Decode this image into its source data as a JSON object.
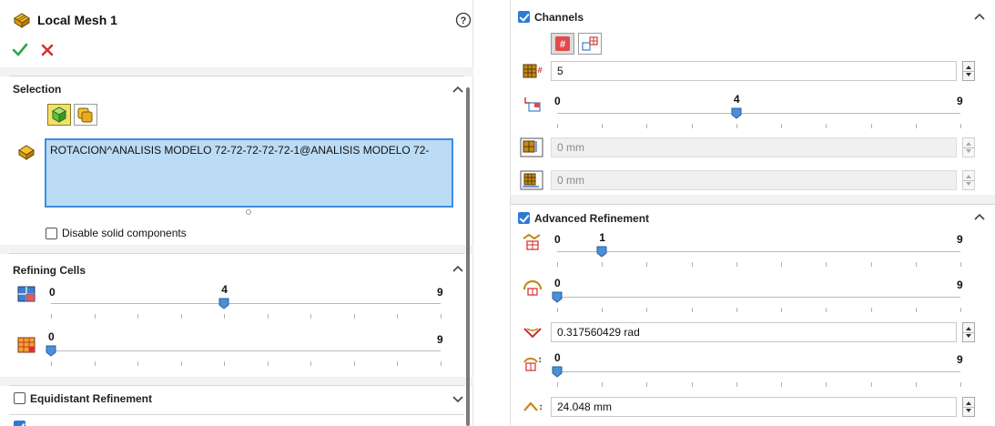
{
  "left": {
    "title": "Local Mesh 1",
    "selection": {
      "title": "Selection",
      "list_item": "ROTACION^ANALISIS MODELO 72-72-72-72-72-1@ANALISIS MODELO 72-",
      "disable_solid_label": "Disable solid components"
    },
    "refining_cells": {
      "title": "Refining Cells",
      "slider1": {
        "min": "0",
        "max": "9",
        "value_label": "4",
        "value": 4
      },
      "slider2": {
        "min": "0",
        "max": "9",
        "value": 0
      }
    },
    "equidistant": {
      "label": "Equidistant Refinement"
    }
  },
  "right": {
    "channels": {
      "title": "Channels",
      "cells_field": "5",
      "slider": {
        "min": "0",
        "max": "9",
        "value_label": "4",
        "value": 4
      },
      "field_a": "0 mm",
      "field_b": "0 mm"
    },
    "advanced": {
      "title": "Advanced Refinement",
      "slider1": {
        "min": "0",
        "max": "9",
        "value_label": "1",
        "value": 1
      },
      "slider2": {
        "min": "0",
        "max": "9",
        "value": 0
      },
      "angle_field": "0.317560429 rad",
      "slider3": {
        "min": "0",
        "max": "9",
        "value": 0
      },
      "length_field": "24.048 mm"
    }
  },
  "colors": {
    "accent_blue": "#2b7bd6",
    "selection_fill": "#bcdcf5",
    "selection_border": "#3a8ee0",
    "ok_green": "#2fa34a",
    "cancel_red": "#d62b2b",
    "thumb_blue": "#4a90d9"
  }
}
